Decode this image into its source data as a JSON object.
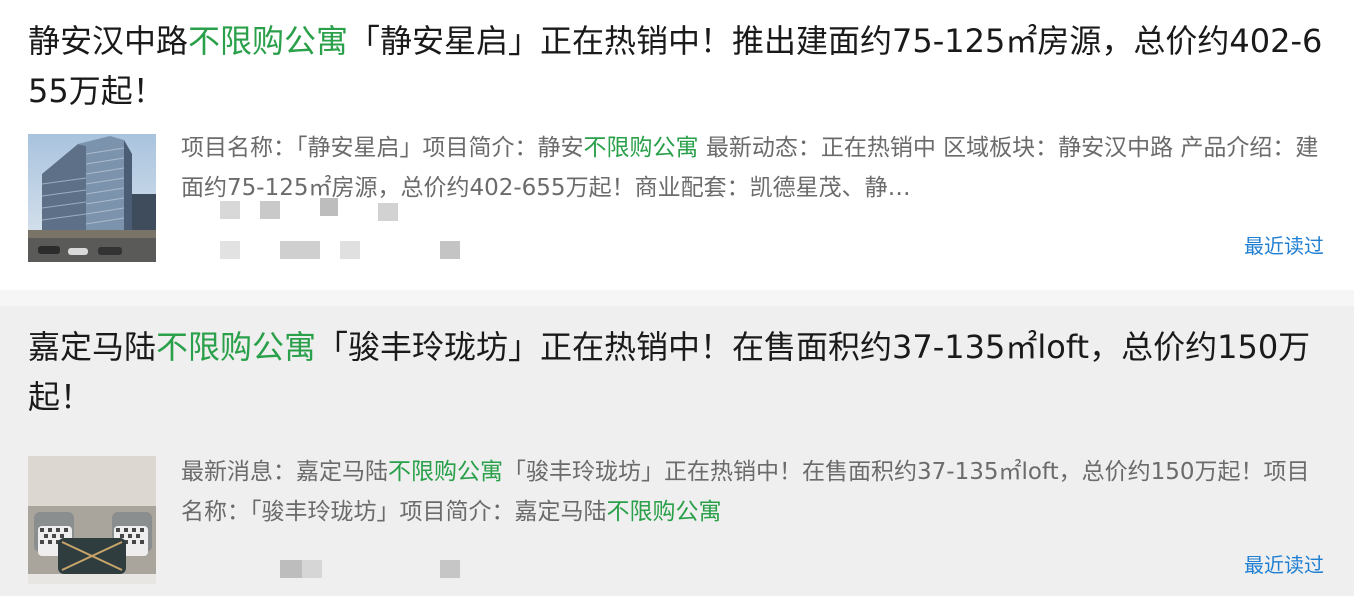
{
  "articles": [
    {
      "title_pre": "静安汉中路",
      "title_hl": "不限购公寓",
      "title_post": "「静安星启」正在热销中！推出建面约75-125㎡房源，总价约402-655万起！",
      "summary_pre": "项目名称：「静安星启」项目简介：静安",
      "summary_hl": "不限购公寓",
      "summary_post": "最新动态：正在热销中 区域板块：静安汉中路 产品介绍：建面约75-125㎡房源，总价约402-655万起！商业配套：凯德星茂、静…",
      "recent_label": "最近读过",
      "thumb_icon": "building-photo"
    },
    {
      "title_pre": "嘉定马陆",
      "title_hl": "不限购公寓",
      "title_post": "「骏丰玲珑坊」正在热销中！在售面积约37-135㎡loft，总价约150万起！",
      "summary_pre": "最新消息：嘉定马陆",
      "summary_hl": "不限购公寓",
      "summary_mid": "「骏丰玲珑坊」正在热销中！在售面积约37-135㎡loft，总价约150万起！项目名称：「骏丰玲珑坊」项目简介：嘉定马陆",
      "summary_hl2": "不限购公寓",
      "recent_label": "最近读过",
      "thumb_icon": "interior-pillow-photo"
    }
  ],
  "colors": {
    "highlight": "#2aa04a",
    "link": "#1f7fd3",
    "title": "#1a1a1a",
    "summary": "#6b6b6b"
  }
}
